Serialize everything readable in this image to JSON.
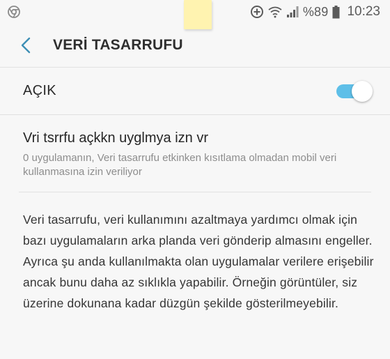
{
  "status_bar": {
    "app_icon": "chrome-icon",
    "icons": [
      "data-saver-icon",
      "wifi-icon",
      "signal-icon",
      "battery-icon"
    ],
    "battery_percent": "%89",
    "time": "10:23"
  },
  "toolbar": {
    "back_icon": "back-arrow-icon",
    "title": "VERİ TASARRUFU"
  },
  "master_switch": {
    "label": "AÇIK",
    "checked": true,
    "accent_color": "#5ebfe8"
  },
  "unrestricted_apps": {
    "title": "Vri tsrrfu açkkn uyglmya izn vr",
    "summary": "0 uygulamanın, Veri tasarrufu etkinken kısıtlama olmadan mobil veri kullanmasına izin veriliyor"
  },
  "description": "Veri tasarrufu, veri kullanımını azaltmaya yardımcı olmak için bazı uygulamaların arka planda veri gönderip almasını engeller. Ayrıca şu anda kullanılmakta olan uygulamalar verilere erişebilir ancak bunu daha az sıklıkla yapabilir. Örneğin görüntüler, siz üzerine dokunana kadar düzgün şekilde gösterilmeyebilir."
}
